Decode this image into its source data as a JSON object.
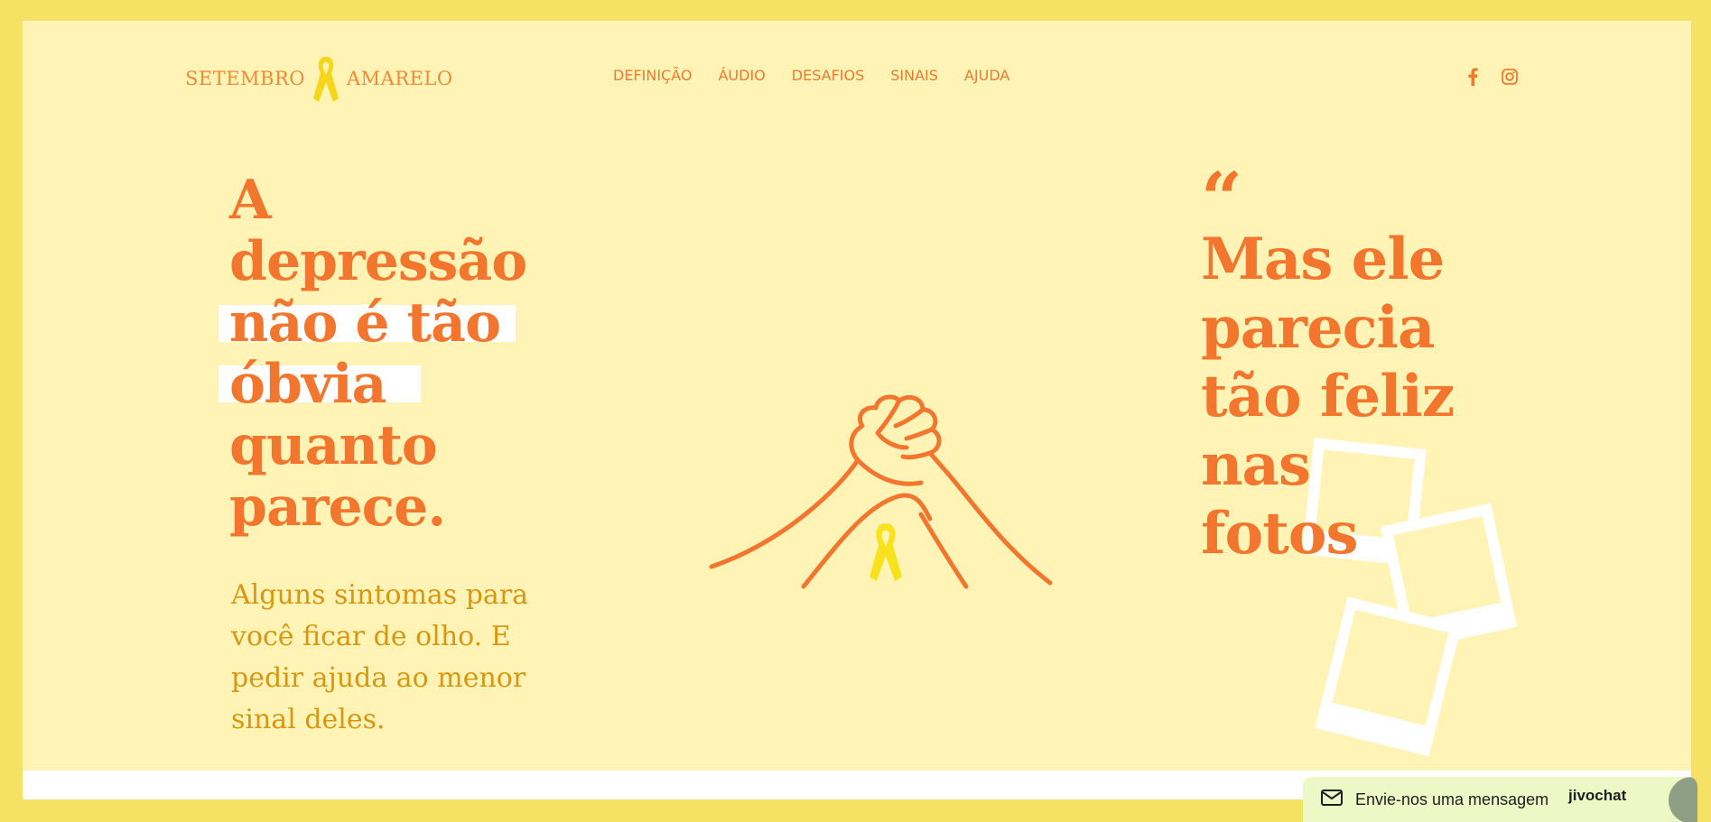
{
  "header": {
    "logo_left": "SETEMBRO",
    "logo_right": "AMARELO",
    "nav": [
      "DEFINIÇÃO",
      "ÁUDIO",
      "DESAFIOS",
      "SINAIS",
      "AJUDA"
    ],
    "social_icons": [
      "facebook-icon",
      "instagram-icon"
    ]
  },
  "hero": {
    "headline_lines": [
      "A",
      "depressão",
      "não é tão",
      "óbvia",
      "quanto",
      "parece."
    ],
    "subtext": "Alguns sintomas para você ficar de olho. E pedir ajuda ao menor sinal deles.",
    "quote_mark": "“",
    "quote_lines": [
      "Mas ele",
      "parecia",
      "tão feliz",
      "nas",
      "fotos"
    ]
  },
  "chat": {
    "label": "Envie-nos uma mensagem",
    "brand": "jivochat"
  },
  "colors": {
    "frame": "#f5e265",
    "background": "#fff4b6",
    "accent_orange": "#f3762e",
    "subtext_mustard": "#d99711",
    "ribbon_yellow": "#f7e21b"
  }
}
